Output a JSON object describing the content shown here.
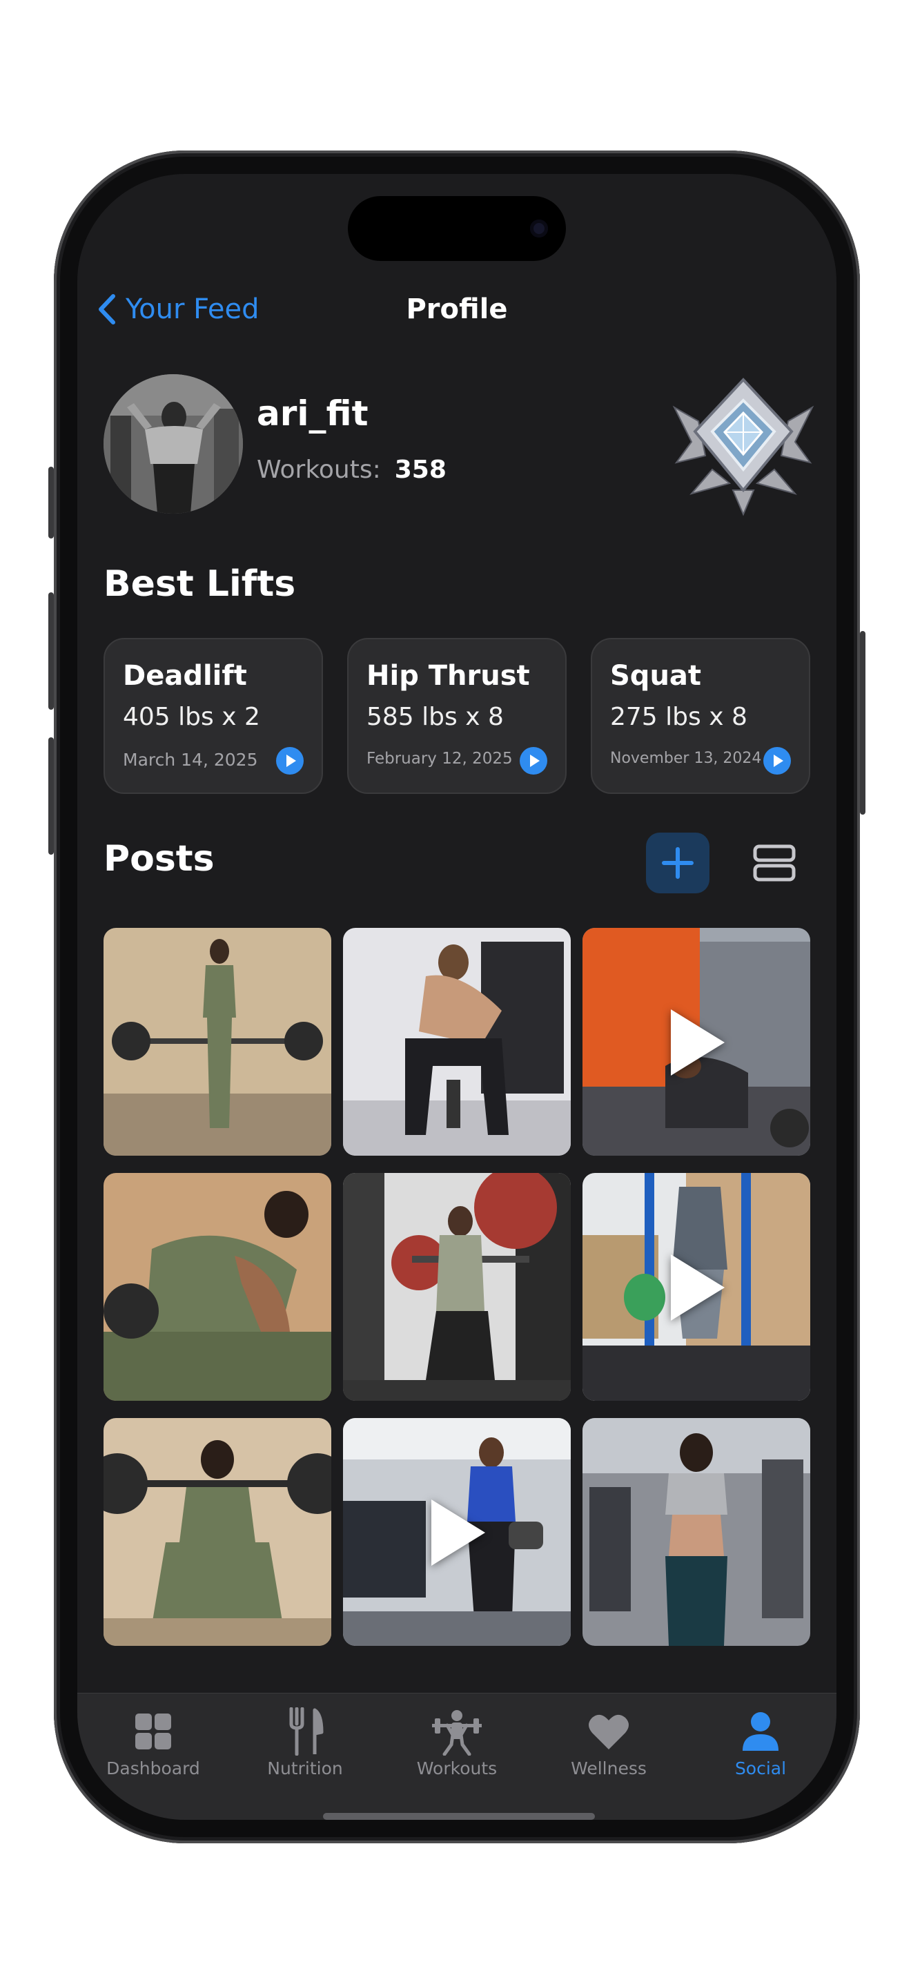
{
  "colors": {
    "accent": "#2f8cf0",
    "background": "#1c1c1e",
    "card": "#2c2c2e",
    "muted": "#8e8e93"
  },
  "nav": {
    "back_label": "Your Feed",
    "title": "Profile"
  },
  "profile": {
    "username": "ari_fit",
    "workouts_label": "Workouts:",
    "workouts_count": "358",
    "badge_icon": "diamond-rank-badge"
  },
  "best_lifts": {
    "title": "Best Lifts",
    "items": [
      {
        "name": "Deadlift",
        "value": "405 lbs x 2",
        "date": "March 14, 2025"
      },
      {
        "name": "Hip Thrust",
        "value": "585 lbs x 8",
        "date": "February 12, 2025"
      },
      {
        "name": "Squat",
        "value": "275 lbs x 8",
        "date": "November 13, 2024"
      }
    ]
  },
  "posts": {
    "title": "Posts",
    "add_icon": "plus-icon",
    "layout_icon": "list-layout-icon",
    "items": [
      {
        "kind": "photo"
      },
      {
        "kind": "photo"
      },
      {
        "kind": "video"
      },
      {
        "kind": "photo"
      },
      {
        "kind": "photo"
      },
      {
        "kind": "video"
      },
      {
        "kind": "photo"
      },
      {
        "kind": "video"
      },
      {
        "kind": "photo"
      }
    ]
  },
  "tabbar": {
    "items": [
      {
        "label": "Dashboard",
        "icon": "grid-icon",
        "active": false
      },
      {
        "label": "Nutrition",
        "icon": "fork-knife-icon",
        "active": false
      },
      {
        "label": "Workouts",
        "icon": "weightlifter-icon",
        "active": false
      },
      {
        "label": "Wellness",
        "icon": "heart-icon",
        "active": false
      },
      {
        "label": "Social",
        "icon": "person-icon",
        "active": true
      }
    ]
  }
}
